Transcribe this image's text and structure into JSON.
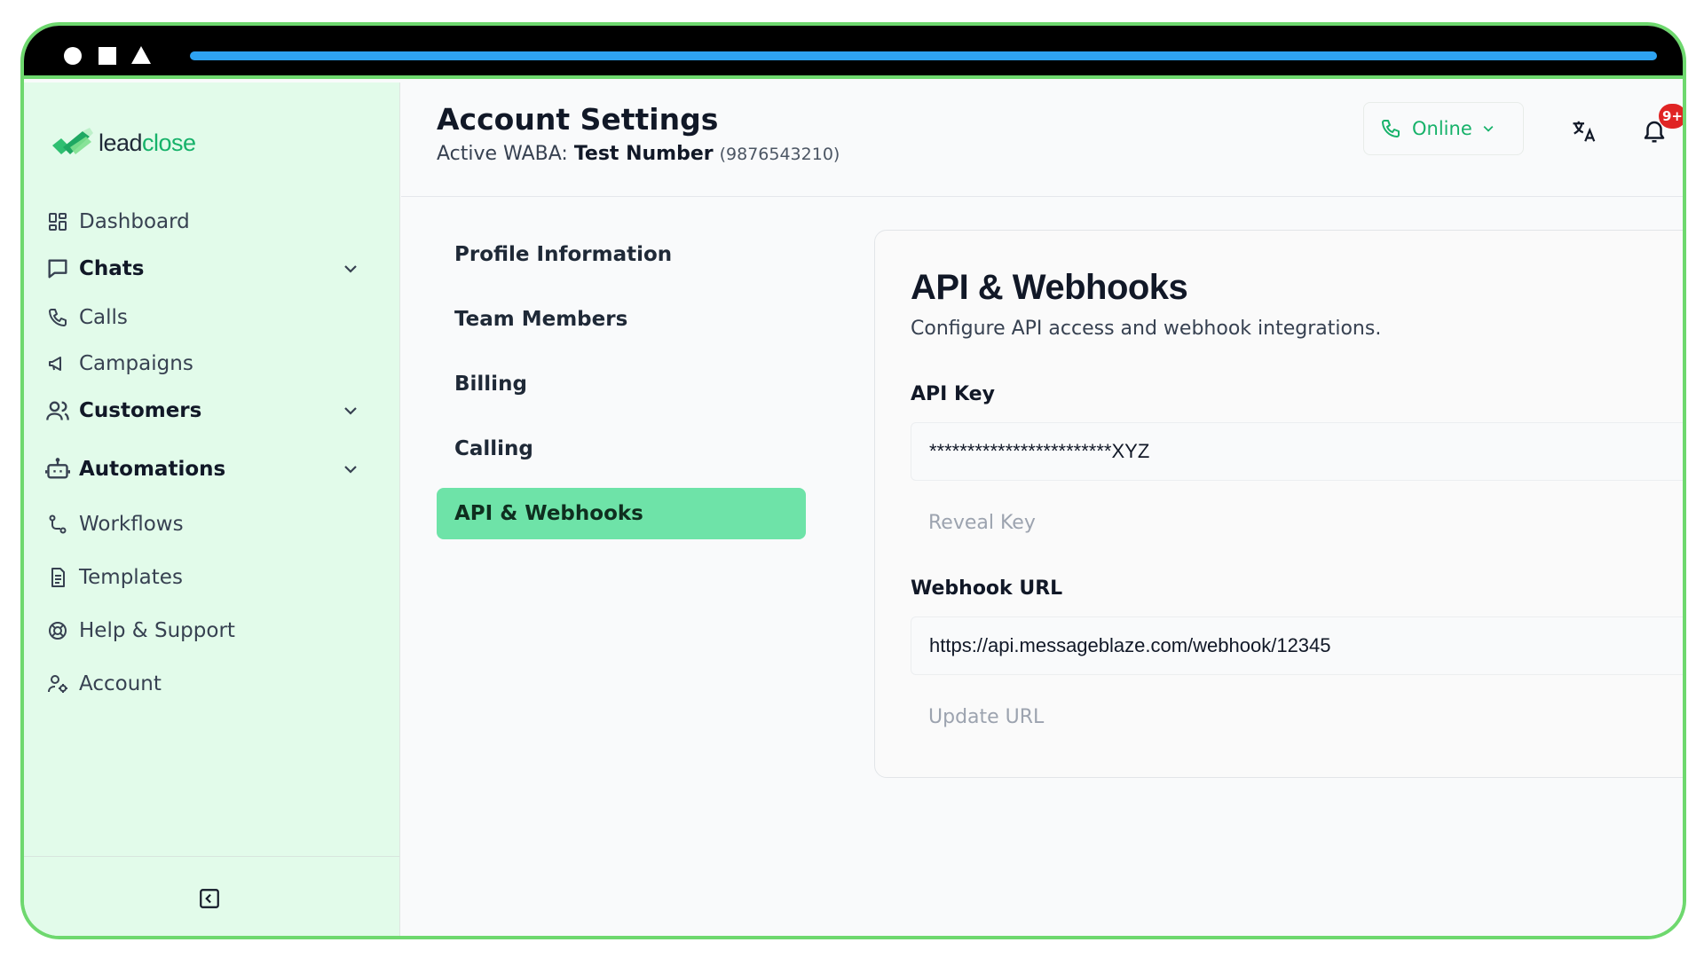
{
  "brand": {
    "name_part1": "lead",
    "name_part2": "close",
    "accent": "#17b26a"
  },
  "sidebar": {
    "items": [
      {
        "label": "Dashboard",
        "icon": "dashboard-icon",
        "group": false
      },
      {
        "label": "Chats",
        "icon": "chat-bubble-icon",
        "group": true
      },
      {
        "label": "Calls",
        "icon": "phone-icon",
        "group": false
      },
      {
        "label": "Campaigns",
        "icon": "megaphone-icon",
        "group": false
      },
      {
        "label": "Customers",
        "icon": "users-icon",
        "group": true
      },
      {
        "label": "Automations",
        "icon": "bot-icon",
        "group": true
      },
      {
        "label": "Workflows",
        "icon": "workflow-icon",
        "group": false
      },
      {
        "label": "Templates",
        "icon": "document-icon",
        "group": false
      },
      {
        "label": "Help & Support",
        "icon": "lifebuoy-icon",
        "group": false
      },
      {
        "label": "Account",
        "icon": "user-gear-icon",
        "group": false
      }
    ],
    "collapse_icon": "collapse-sidebar-icon"
  },
  "header": {
    "title": "Account Settings",
    "waba_prefix": "Active WABA:",
    "waba_name": "Test Number",
    "waba_phone": "(9876543210)",
    "status_label": "Online",
    "notification_count": "9+"
  },
  "settings_nav": {
    "items": [
      "Profile Information",
      "Team Members",
      "Billing",
      "Calling",
      "API & Webhooks"
    ],
    "active": "API & Webhooks"
  },
  "api_panel": {
    "title": "API & Webhooks",
    "subtitle": "Configure API access and webhook integrations.",
    "api_key_label": "API Key",
    "api_key_value": "************************XYZ",
    "reveal_button": "Reveal Key",
    "webhook_label": "Webhook URL",
    "webhook_value": "https://api.messageblaze.com/webhook/12345",
    "update_button": "Update URL"
  }
}
